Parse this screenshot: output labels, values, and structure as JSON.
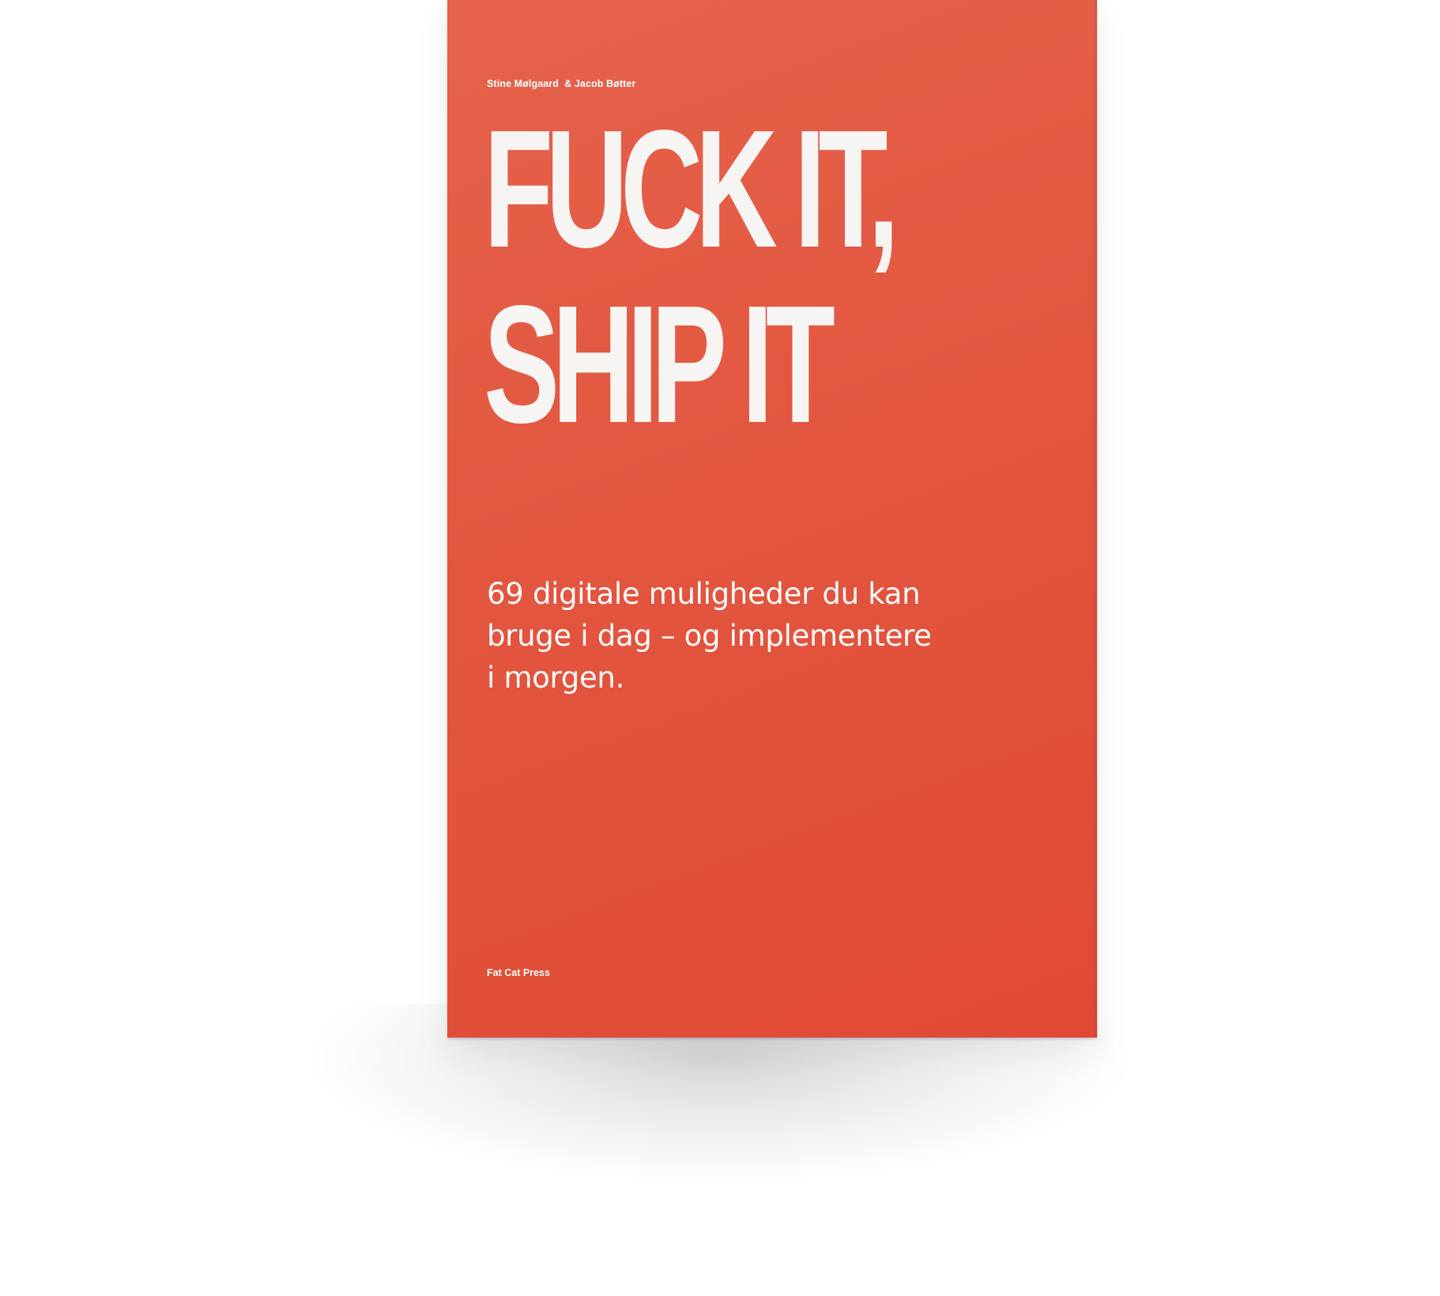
{
  "book": {
    "authors": "Stine Mølgaard  & Jacob Bøtter",
    "title_lines": [
      "FUCK IT,",
      "SHIP IT"
    ],
    "subtitle_lines": [
      "69 digitale muligheder du kan",
      "bruge i dag – og implementere",
      "i morgen."
    ],
    "publisher": "Fat Cat Press",
    "cover_color": "#e2553f",
    "text_color": "#ffffff"
  }
}
